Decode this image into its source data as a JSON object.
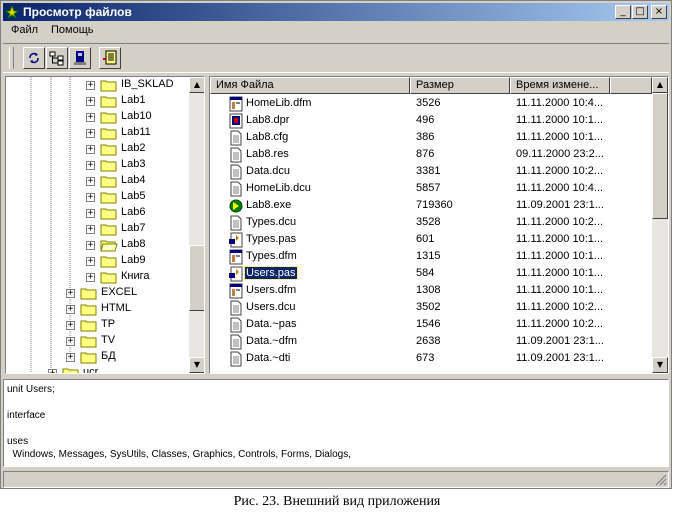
{
  "window": {
    "title": "Просмотр файлов"
  },
  "menu": {
    "file": "Файл",
    "help": "Помощь"
  },
  "tree": {
    "items": [
      {
        "label": "IB_SKLAD",
        "indent": 2,
        "open": false
      },
      {
        "label": "Lab1",
        "indent": 2,
        "open": false
      },
      {
        "label": "Lab10",
        "indent": 2,
        "open": false
      },
      {
        "label": "Lab11",
        "indent": 2,
        "open": false
      },
      {
        "label": "Lab2",
        "indent": 2,
        "open": false
      },
      {
        "label": "Lab3",
        "indent": 2,
        "open": false
      },
      {
        "label": "Lab4",
        "indent": 2,
        "open": false
      },
      {
        "label": "Lab5",
        "indent": 2,
        "open": false
      },
      {
        "label": "Lab6",
        "indent": 2,
        "open": false
      },
      {
        "label": "Lab7",
        "indent": 2,
        "open": false
      },
      {
        "label": "Lab8",
        "indent": 2,
        "open": true
      },
      {
        "label": "Lab9",
        "indent": 2,
        "open": false
      },
      {
        "label": "Книга",
        "indent": 2,
        "open": false
      },
      {
        "label": "EXCEL",
        "indent": 1,
        "open": false
      },
      {
        "label": "HTML",
        "indent": 1,
        "open": false
      },
      {
        "label": "TP",
        "indent": 1,
        "open": false
      },
      {
        "label": "TV",
        "indent": 1,
        "open": false
      },
      {
        "label": "БД",
        "indent": 1,
        "open": false
      },
      {
        "label": "ucr",
        "indent": 0,
        "open": false
      }
    ]
  },
  "list": {
    "columns": [
      "Имя Файла",
      "Размер",
      "Время измене..."
    ],
    "rows": [
      {
        "name": "HomeLib.dfm",
        "size": "3526",
        "time": "11.11.2000 10:4...",
        "icon": "form-icon"
      },
      {
        "name": "Lab8.dpr",
        "size": "496",
        "time": "11.11.2000 10:1...",
        "icon": "project-icon"
      },
      {
        "name": "Lab8.cfg",
        "size": "386",
        "time": "11.11.2000 10:1...",
        "icon": "document-icon"
      },
      {
        "name": "Lab8.res",
        "size": "876",
        "time": "09.11.2000 23:2...",
        "icon": "document-icon"
      },
      {
        "name": "Data.dcu",
        "size": "3381",
        "time": "11.11.2000 10:2...",
        "icon": "document-icon"
      },
      {
        "name": "HomeLib.dcu",
        "size": "5857",
        "time": "11.11.2000 10:4...",
        "icon": "document-icon"
      },
      {
        "name": "Lab8.exe",
        "size": "719360",
        "time": "11.09.2001 23:1...",
        "icon": "exe-icon"
      },
      {
        "name": "Types.dcu",
        "size": "3528",
        "time": "11.11.2000 10:2...",
        "icon": "document-icon"
      },
      {
        "name": "Types.pas",
        "size": "601",
        "time": "11.11.2000 10:1...",
        "icon": "pascal-unit-icon"
      },
      {
        "name": "Types.dfm",
        "size": "1315",
        "time": "11.11.2000 10:1...",
        "icon": "form-icon"
      },
      {
        "name": "Users.pas",
        "size": "584",
        "time": "11.11.2000 10:1...",
        "icon": "pascal-unit-icon",
        "selected": true
      },
      {
        "name": "Users.dfm",
        "size": "1308",
        "time": "11.11.2000 10:1...",
        "icon": "form-icon"
      },
      {
        "name": "Users.dcu",
        "size": "3502",
        "time": "11.11.2000 10:2...",
        "icon": "document-icon"
      },
      {
        "name": "Data.~pas",
        "size": "1546",
        "time": "11.11.2000 10:2...",
        "icon": "document-icon"
      },
      {
        "name": "Data.~dfm",
        "size": "2638",
        "time": "11.09.2001 23:1...",
        "icon": "document-icon"
      },
      {
        "name": "Data.~dti",
        "size": "673",
        "time": "11.09.2001 23:1...",
        "icon": "document-icon"
      }
    ]
  },
  "editor": {
    "lines": [
      "unit Users;",
      "",
      "interface",
      "",
      "uses",
      "  Windows, Messages, SysUtils, Classes, Graphics, Controls, Forms, Dialogs,"
    ]
  },
  "caption": "Рис. 23. Внешний вид приложения",
  "colors": {
    "titlebar": "#0a246a",
    "face": "#d4d0c8",
    "selection": "#0a246a",
    "folder": "#ffff80"
  }
}
